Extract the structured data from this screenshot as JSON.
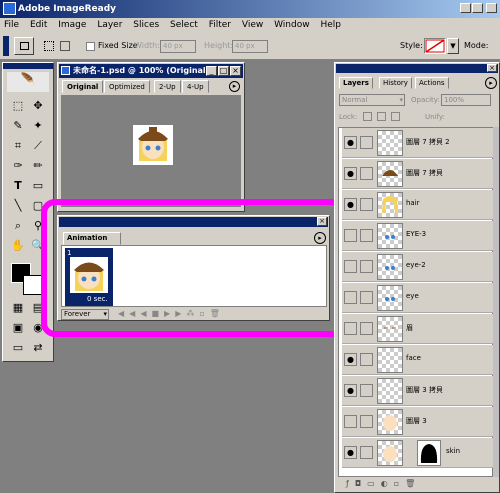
{
  "window": {
    "title": "Adobe ImageReady"
  },
  "menu": [
    "File",
    "Edit",
    "Image",
    "Layer",
    "Slices",
    "Select",
    "Filter",
    "View",
    "Window",
    "Help"
  ],
  "options": {
    "fixed_size_label": "Fixed Size",
    "width_label": "Width:",
    "width_value": "40 px",
    "height_label": "Height:",
    "height_value": "40 px",
    "style_label": "Style:",
    "mode_label": "Mode:"
  },
  "document": {
    "title": "未命名-1.psd @ 100% (Original)",
    "tabs": [
      "Original",
      "Optimized",
      "2-Up",
      "4-Up"
    ],
    "active_tab": "Original"
  },
  "animation": {
    "tab": "Animation",
    "frames": [
      {
        "number": "1",
        "delay": "0 sec."
      }
    ],
    "loop": "Forever"
  },
  "layers_palette": {
    "tabs": [
      "Layers",
      "History",
      "Actions"
    ],
    "blend_mode": "Normal",
    "opacity_label": "Opacity:",
    "opacity_value": "100%",
    "lock_label": "Lock:",
    "unify_label": "Unify:",
    "layers": [
      {
        "name": "圖層 7 拷貝 2",
        "visible": true,
        "thumb": "empty"
      },
      {
        "name": "圖層 7 拷貝",
        "visible": true,
        "thumb": "hat"
      },
      {
        "name": "hair",
        "visible": true,
        "thumb": "hair"
      },
      {
        "name": "EYE-3",
        "visible": false,
        "thumb": "eyes"
      },
      {
        "name": "eye-2",
        "visible": false,
        "thumb": "eyes"
      },
      {
        "name": "eye",
        "visible": false,
        "thumb": "eyes"
      },
      {
        "name": "眉",
        "visible": false,
        "thumb": "brows"
      },
      {
        "name": "face",
        "visible": true,
        "thumb": "empty"
      },
      {
        "name": "圖層 3 拷貝",
        "visible": true,
        "thumb": "empty"
      },
      {
        "name": "圖層 3",
        "visible": false,
        "thumb": "face"
      },
      {
        "name": "skin",
        "visible": true,
        "thumb": "skin"
      }
    ]
  }
}
